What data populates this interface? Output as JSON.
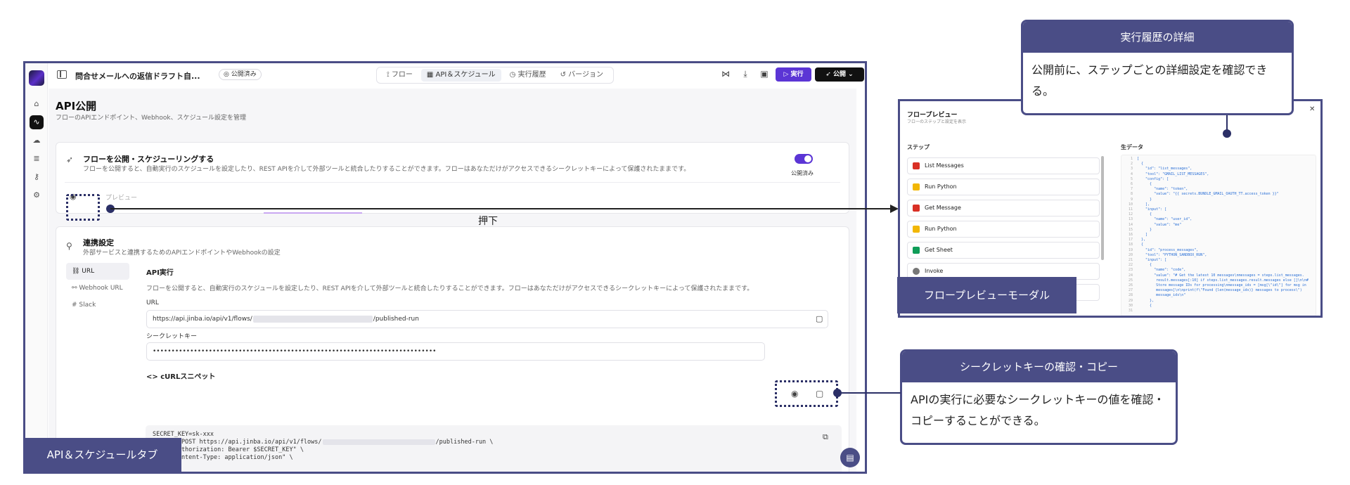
{
  "app": {
    "flow_title": "問合せメールへの返信ドラフト自...",
    "status_badge": "公開済み",
    "tabs": [
      {
        "label": "フロー",
        "icon": "flow-icon"
      },
      {
        "label": "API＆スケジュール",
        "icon": "calendar-icon",
        "active": true
      },
      {
        "label": "実行履歴",
        "icon": "clock-icon"
      },
      {
        "label": "バージョン",
        "icon": "history-icon"
      }
    ],
    "run_label": "実行",
    "publish_label": "公開"
  },
  "page": {
    "title": "API公開",
    "subtitle": "フローのAPIエンドポイント、Webhook、スケジュール設定を管理"
  },
  "publish_card": {
    "title": "フローを公開・スケジューリングする",
    "description": "フローを公開すると、自動実行のスケジュールを設定したり、REST APIを介して外部ツールと統合したりすることができます。フローはあなただけがアクセスできるシークレットキーによって保護されたままです。",
    "toggle_label": "公開済み",
    "preview_label": "プレビュー"
  },
  "integration_card": {
    "title": "連携設定",
    "description": "外部サービスと連携するためのAPIエンドポイントやWebhookの設定",
    "nav": [
      {
        "label": "URL",
        "active": true
      },
      {
        "label": "Webhook URL"
      },
      {
        "label": "Slack"
      }
    ],
    "api_section_title": "API実行",
    "api_section_desc": "フローを公開すると、自動実行のスケジュールを設定したり、REST APIを介して外部ツールと統合したりすることができます。フローはあなただけがアクセスできるシークレットキーによって保護されたままです。",
    "url_label": "URL",
    "url_prefix": "https://api.jinba.io/api/v1/flows/",
    "url_suffix": "/published-run",
    "secret_label": "シークレットキー",
    "secret_value": "••••••••••••••••••••••••••••••••••••••••••••••••••••••••••••••••••••••••••••",
    "curl_label": "cURLスニペット",
    "curl_lines": [
      "SECRET_KEY=sk-xxx",
      "curl -X POST https://api.jinba.io/api/v1/flows/",
      "/published-run \\",
      "  -H \"Authorization: Bearer $SECRET_KEY\" \\",
      "  -H \"Content-Type: application/json\" \\"
    ]
  },
  "labels": {
    "press": "押下",
    "api_schedule_tab": "API＆スケジュールタブ",
    "flow_preview_modal": "フロープレビューモーダル"
  },
  "modal": {
    "title": "フロープレビュー",
    "subtitle": "フローのステップと設定を表示",
    "steps_label": "ステップ",
    "raw_label": "生データ",
    "steps": [
      {
        "label": "List Messages",
        "icon": "gmail-icon",
        "color": "#d93025"
      },
      {
        "label": "Run Python",
        "icon": "python-icon",
        "color": "#f2b705"
      },
      {
        "label": "Get Message",
        "icon": "gmail-icon",
        "color": "#d93025"
      },
      {
        "label": "Run Python",
        "icon": "python-icon",
        "color": "#f2b705"
      },
      {
        "label": "Get Sheet",
        "icon": "sheets-icon",
        "color": "#0f9d58"
      },
      {
        "label": "Invoke",
        "icon": "invoke-icon",
        "color": "#555555"
      }
    ],
    "json_text": "[\n  {\n    \"id\": \"list_messages\",\n    \"tool\": \"GMAIL_LIST_MESSAGES\",\n    \"config\": [\n      {\n        \"name\": \"token\",\n        \"value\": \"{{ secrets.BUNDLE_GMAIL_OAUTH_TT.access_token }}\"\n      }\n    ],\n    \"input\": [\n      {\n        \"name\": \"user_id\",\n        \"value\": \"me\"\n      }\n    ]\n  },\n  {\n    \"id\": \"process_messages\",\n    \"tool\": \"PYTHON_SANDBOX_RUN\",\n    \"input\": [\n      {\n        \"name\": \"code\",\n        \"value\": \"# Get the latest 10 messages\\nmessages = steps.list_messages.\n         result.messages[:10] if steps.list_messages.result.messages else []\\n\\n#\n         Store message IDs for processing\\nmessage_ids = [msg[\\\"id\\\"] for msg in\n         messages]\\n\\nprint(f\\\"Found {len(message_ids)} messages to process\\\")\n         message_ids\\n\"\n      },\n      {"
  },
  "callouts": {
    "history": {
      "title": "実行履歴の詳細",
      "body": "公開前に、ステップごとの詳細設定を確認できる。"
    },
    "secret": {
      "title": "シークレットキーの確認・コピー",
      "body": "APIの実行に必要なシークレットキーの値を確認・コピーすることができる。"
    }
  },
  "colors": {
    "accent": "#5b35d5",
    "annotation": "#4a4d86"
  }
}
